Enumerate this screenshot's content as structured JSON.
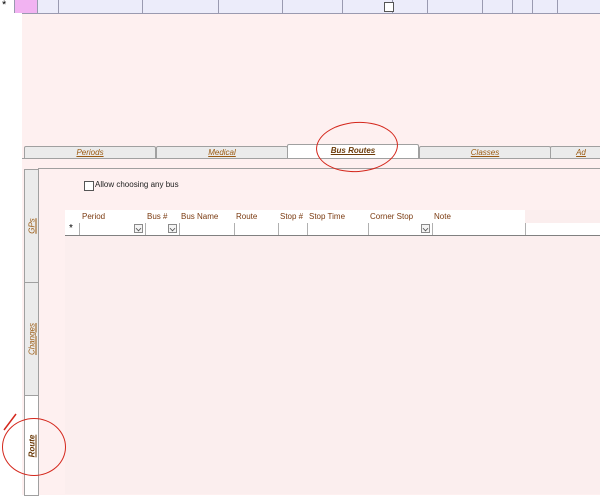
{
  "top_row": {
    "new_record_marker": "*"
  },
  "tabs": [
    {
      "label": "Periods",
      "active": false
    },
    {
      "label": "Medical",
      "active": false
    },
    {
      "label": "Bus Routes",
      "active": true
    },
    {
      "label": "Classes",
      "active": false
    },
    {
      "label": "Ad",
      "active": false
    }
  ],
  "vertical_tabs": [
    {
      "label": "GPs",
      "active": false
    },
    {
      "label": "Changes",
      "active": false
    },
    {
      "label": "Route",
      "active": true
    }
  ],
  "allow_any_bus": {
    "label": "Allow choosing any bus",
    "checked": false
  },
  "grid": {
    "columns": [
      "Period",
      "Bus #",
      "Bus Name",
      "Route",
      "Stop #",
      "Stop Time",
      "Corner Stop",
      "Note"
    ],
    "new_record_marker": "*"
  },
  "annotation_color": "#d4271c"
}
